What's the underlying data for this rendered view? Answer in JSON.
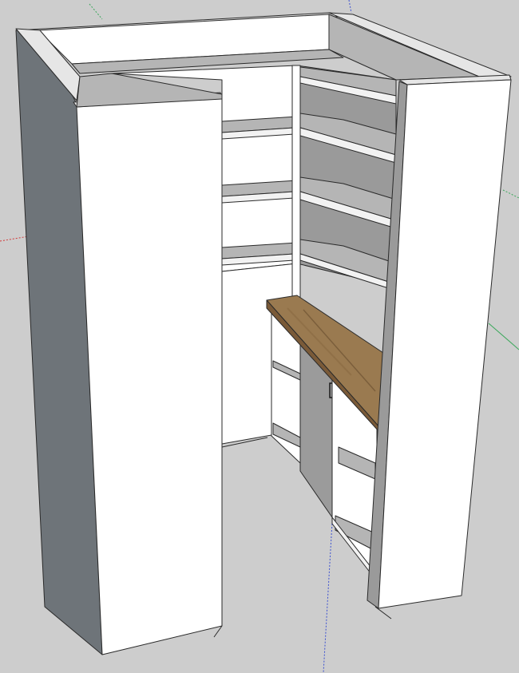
{
  "viewport": {
    "background_color": "#cdcdcd",
    "projection": "perspective"
  },
  "axes": {
    "red": "#d23a3a",
    "green": "#3aa85a",
    "blue": "#3a4fd0"
  },
  "colors": {
    "panel_face": "#ffffff",
    "panel_side": "#6e7479",
    "panel_top": "#e6e6e6",
    "shelf_edge": "#f2f2f2",
    "shelf_top": "#b5b5b5",
    "inner_shadow": "#9a9a9a",
    "door": "#9b9b9b",
    "countertop": "#7a5a38",
    "countertop_light": "#9a7a50",
    "edge_line": "#2a2a2a"
  },
  "model": {
    "name": "",
    "components": [
      {
        "name": "left-panel",
        "icon": "panel-icon"
      },
      {
        "name": "left-front-panel",
        "icon": "panel-icon"
      },
      {
        "name": "back-shelving",
        "icon": "shelf-icon"
      },
      {
        "name": "right-shelving",
        "icon": "shelf-icon"
      },
      {
        "name": "base-cabinet",
        "icon": "cabinet-icon"
      },
      {
        "name": "countertop",
        "icon": "countertop-icon"
      },
      {
        "name": "right-front-panel",
        "icon": "panel-icon"
      }
    ]
  }
}
